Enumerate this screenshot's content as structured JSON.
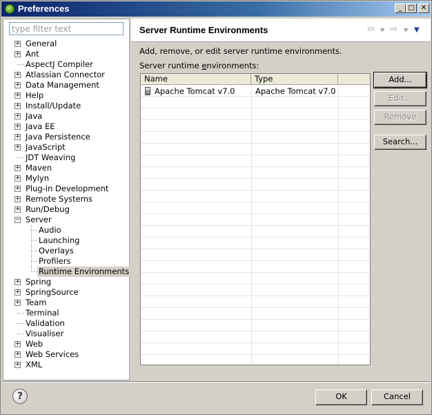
{
  "window": {
    "title": "Preferences",
    "min": "_",
    "max": "□",
    "close": "✕"
  },
  "filter": {
    "placeholder": "type filter text",
    "value": ""
  },
  "tree": [
    {
      "label": "General",
      "expandable": true,
      "level": 0
    },
    {
      "label": "Ant",
      "expandable": true,
      "level": 0
    },
    {
      "label": "AspectJ Compiler",
      "expandable": false,
      "level": 0
    },
    {
      "label": "Atlassian Connector",
      "expandable": true,
      "level": 0
    },
    {
      "label": "Data Management",
      "expandable": true,
      "level": 0
    },
    {
      "label": "Help",
      "expandable": true,
      "level": 0
    },
    {
      "label": "Install/Update",
      "expandable": true,
      "level": 0
    },
    {
      "label": "Java",
      "expandable": true,
      "level": 0
    },
    {
      "label": "Java EE",
      "expandable": true,
      "level": 0
    },
    {
      "label": "Java Persistence",
      "expandable": true,
      "level": 0
    },
    {
      "label": "JavaScript",
      "expandable": true,
      "level": 0
    },
    {
      "label": "JDT Weaving",
      "expandable": false,
      "level": 0
    },
    {
      "label": "Maven",
      "expandable": true,
      "level": 0
    },
    {
      "label": "Mylyn",
      "expandable": true,
      "level": 0
    },
    {
      "label": "Plug-in Development",
      "expandable": true,
      "level": 0
    },
    {
      "label": "Remote Systems",
      "expandable": true,
      "level": 0
    },
    {
      "label": "Run/Debug",
      "expandable": true,
      "level": 0
    },
    {
      "label": "Server",
      "expandable": true,
      "expanded": true,
      "level": 0
    },
    {
      "label": "Audio",
      "expandable": false,
      "level": 1
    },
    {
      "label": "Launching",
      "expandable": false,
      "level": 1
    },
    {
      "label": "Overlays",
      "expandable": false,
      "level": 1
    },
    {
      "label": "Profilers",
      "expandable": false,
      "level": 1
    },
    {
      "label": "Runtime Environments",
      "expandable": false,
      "level": 1,
      "selected": true
    },
    {
      "label": "Spring",
      "expandable": true,
      "level": 0
    },
    {
      "label": "SpringSource",
      "expandable": true,
      "level": 0
    },
    {
      "label": "Team",
      "expandable": true,
      "level": 0
    },
    {
      "label": "Terminal",
      "expandable": false,
      "level": 0
    },
    {
      "label": "Validation",
      "expandable": false,
      "level": 0
    },
    {
      "label": "Visualiser",
      "expandable": false,
      "level": 0
    },
    {
      "label": "Web",
      "expandable": true,
      "level": 0
    },
    {
      "label": "Web Services",
      "expandable": true,
      "level": 0
    },
    {
      "label": "XML",
      "expandable": true,
      "level": 0
    }
  ],
  "page": {
    "title": "Server Runtime Environments",
    "description": "Add, remove, or edit server runtime environments.",
    "table_label": "Server runtime environments:",
    "nav": {
      "back": "⇦",
      "back_dd": "▼",
      "forward": "⇨",
      "forward_dd": "▼",
      "menu": "▼"
    }
  },
  "table": {
    "columns": [
      "Name",
      "Type",
      ""
    ],
    "rows": [
      {
        "name": "Apache Tomcat v7.0",
        "type": "Apache Tomcat v7.0",
        "icon": "server-icon"
      }
    ]
  },
  "buttons": {
    "add": "Add...",
    "edit": "Edit...",
    "remove": "Remove",
    "search": "Search...",
    "ok": "OK",
    "cancel": "Cancel",
    "help": "?"
  },
  "colors": {
    "titlebar_start": "#0a246a",
    "titlebar_end": "#a6caf0",
    "dialog_bg": "#d4d0c8"
  }
}
